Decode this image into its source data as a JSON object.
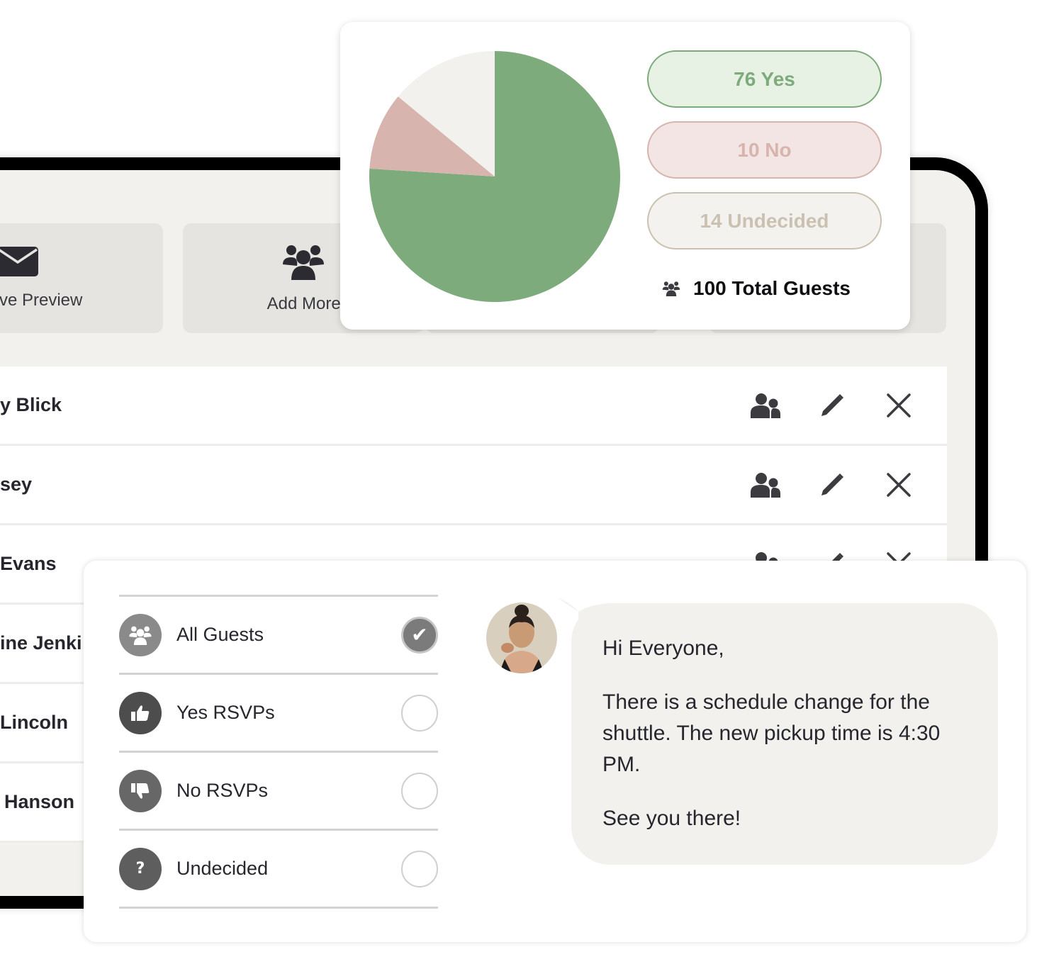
{
  "colors": {
    "yes": "#7dab7c",
    "no": "#d7b4ae",
    "undecided": "#f2f1ed",
    "icon_dark": "#3b3b40"
  },
  "toolbar": {
    "tiles": [
      {
        "label": "Live Preview",
        "visible_label": "ive Preview",
        "icon": "envelope-icon"
      },
      {
        "label": "Add More Guests",
        "visible_label": "Add More Gu",
        "icon": "group-icon"
      }
    ]
  },
  "guests": [
    {
      "visible_name": "y Blick"
    },
    {
      "visible_name": "sey"
    },
    {
      "visible_name": "Evans"
    },
    {
      "visible_name": "ine Jenki"
    },
    {
      "visible_name": "Lincoln"
    },
    {
      "visible_name": "Hanson"
    }
  ],
  "stats": {
    "yes_label": "76 Yes",
    "no_label": "10 No",
    "undecided_label": "14 Undecided",
    "total_label": "100 Total Guests"
  },
  "chart_data": {
    "type": "pie",
    "title": "",
    "start": "top",
    "direction": "clockwise",
    "slices": [
      {
        "label": "Yes",
        "value": 76,
        "color": "#7dab7c"
      },
      {
        "label": "No",
        "value": 10,
        "color": "#d7b4ae"
      },
      {
        "label": "Undecided",
        "value": 14,
        "color": "#f2f1ed"
      }
    ],
    "total": 100
  },
  "audience": {
    "items": [
      {
        "label": "All Guests",
        "icon": "group-icon",
        "checked": true
      },
      {
        "label": "Yes RSVPs",
        "icon": "thumbs-up-icon",
        "checked": false
      },
      {
        "label": "No RSVPs",
        "icon": "thumbs-down-icon",
        "checked": false
      },
      {
        "label": "Undecided",
        "icon": "question-icon",
        "checked": false
      }
    ],
    "check_glyph": "✔"
  },
  "message": {
    "greeting": "Hi Everyone,",
    "body": "There is a schedule change for the shuttle. The new pickup time is 4:30 PM.",
    "closing": "See you there!"
  }
}
